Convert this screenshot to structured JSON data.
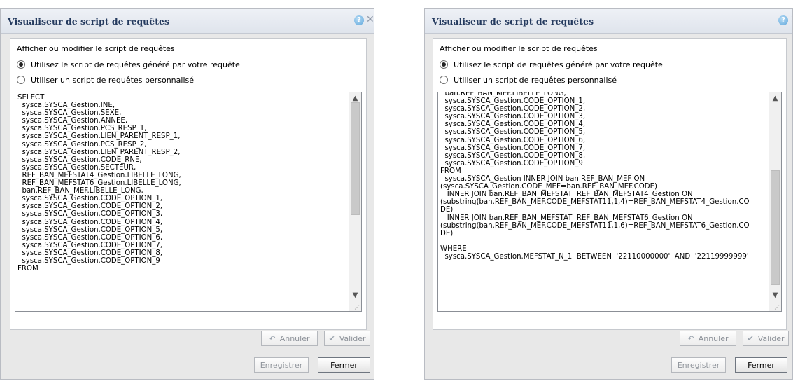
{
  "dialogs": [
    {
      "title": "Visualiseur de script de requêtes",
      "help_icon": "?",
      "close_icon": "✕",
      "heading": "Afficher ou modifier le script de requêtes",
      "option_generated": "Utilisez le script de requêtes généré par votre requête",
      "option_custom": "Utiliser un script de requêtes personnalisé",
      "selected_option": "generated",
      "scroll_position": 0.12,
      "code_lines": [
        "SELECT",
        "  sysca.SYSCA_Gestion.INE,",
        "  sysca.SYSCA_Gestion.SEXE,",
        "  sysca.SYSCA_Gestion.ANNEE,",
        "  sysca.SYSCA_Gestion.PCS_RESP_1,",
        "  sysca.SYSCA_Gestion.LIEN_PARENT_RESP_1,",
        "  sysca.SYSCA_Gestion.PCS_RESP_2,",
        "  sysca.SYSCA_Gestion.LIEN_PARENT_RESP_2,",
        "  sysca.SYSCA_Gestion.CODE_RNE,",
        "  sysca.SYSCA_Gestion.SECTEUR,",
        "  REF_BAN_MEFSTAT4_Gestion.LIBELLE_LONG,",
        "  REF_BAN_MEFSTAT6_Gestion.LIBELLE_LONG,",
        "  ban.REF_BAN_MEF.LIBELLE_LONG,",
        "  sysca.SYSCA_Gestion.CODE_OPTION_1,",
        "  sysca.SYSCA_Gestion.CODE_OPTION_2,",
        "  sysca.SYSCA_Gestion.CODE_OPTION_3,",
        "  sysca.SYSCA_Gestion.CODE_OPTION_4,",
        "  sysca.SYSCA_Gestion.CODE_OPTION_5,",
        "  sysca.SYSCA_Gestion.CODE_OPTION_6,",
        "  sysca.SYSCA_Gestion.CODE_OPTION_7,",
        "  sysca.SYSCA_Gestion.CODE_OPTION_8,",
        "  sysca.SYSCA_Gestion.CODE_OPTION_9",
        "FROM"
      ],
      "cancel_label": "Annuler",
      "validate_label": "Valider",
      "save_label": "Enregistrer",
      "close_label": "Fermer"
    },
    {
      "title": "Visualiseur de script de requêtes",
      "help_icon": "?",
      "close_icon": "✕",
      "heading": "Afficher ou modifier le script de requêtes",
      "option_generated": "Utilisez le script de requêtes généré par votre requête",
      "option_custom": "Utiliser un script de requêtes personnalisé",
      "selected_option": "generated",
      "scroll_position": 0.95,
      "code_lines": [
        "  ban.REF_BAN_MEF.LIBELLE_LONG,",
        "  sysca.SYSCA_Gestion.CODE_OPTION_1,",
        "  sysca.SYSCA_Gestion.CODE_OPTION_2,",
        "  sysca.SYSCA_Gestion.CODE_OPTION_3,",
        "  sysca.SYSCA_Gestion.CODE_OPTION_4,",
        "  sysca.SYSCA_Gestion.CODE_OPTION_5,",
        "  sysca.SYSCA_Gestion.CODE_OPTION_6,",
        "  sysca.SYSCA_Gestion.CODE_OPTION_7,",
        "  sysca.SYSCA_Gestion.CODE_OPTION_8,",
        "  sysca.SYSCA_Gestion.CODE_OPTION_9",
        "FROM",
        "  sysca.SYSCA_Gestion INNER JOIN ban.REF_BAN_MEF ON",
        "(sysca.SYSCA_Gestion.CODE_MEF=ban.REF_BAN_MEF.CODE)",
        "   INNER JOIN ban.REF_BAN_MEFSTAT  REF_BAN_MEFSTAT4_Gestion ON",
        "(substring(ban.REF_BAN_MEF.CODE_MEFSTAT11,1,4)=REF_BAN_MEFSTAT4_Gestion.CO",
        "DE)",
        "   INNER JOIN ban.REF_BAN_MEFSTAT  REF_BAN_MEFSTAT6_Gestion ON",
        "(substring(ban.REF_BAN_MEF.CODE_MEFSTAT11,1,6)=REF_BAN_MEFSTAT6_Gestion.CO",
        "DE)",
        "",
        "WHERE",
        "  sysca.SYSCA_Gestion.MEFSTAT_N_1  BETWEEN  '22110000000'  AND  '22119999999'"
      ],
      "cancel_label": "Annuler",
      "validate_label": "Valider",
      "save_label": "Enregistrer",
      "close_label": "Fermer"
    }
  ]
}
